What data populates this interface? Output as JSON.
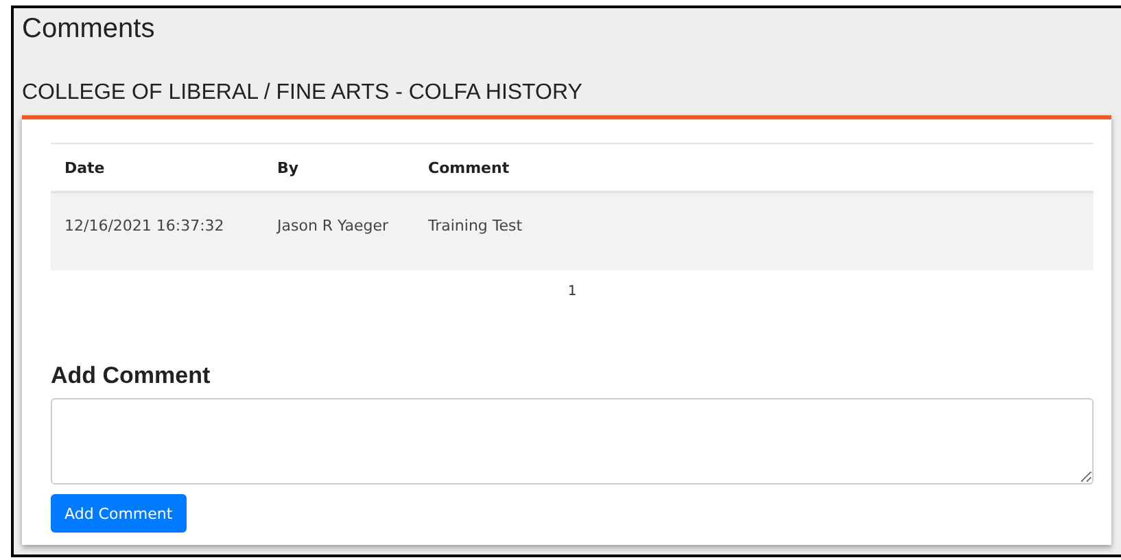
{
  "title": "Comments",
  "subtitle": "COLLEGE OF LIBERAL / FINE ARTS - COLFA HISTORY",
  "table": {
    "columns": [
      "Date",
      "By",
      "Comment"
    ],
    "rows": [
      [
        "12/16/2021 16:37:32",
        "Jason R Yaeger",
        "Training Test"
      ]
    ]
  },
  "pager": [
    {
      "label": "1",
      "selected": true
    }
  ],
  "add_comment": {
    "heading": "Add Comment",
    "button": "Add Comment"
  }
}
